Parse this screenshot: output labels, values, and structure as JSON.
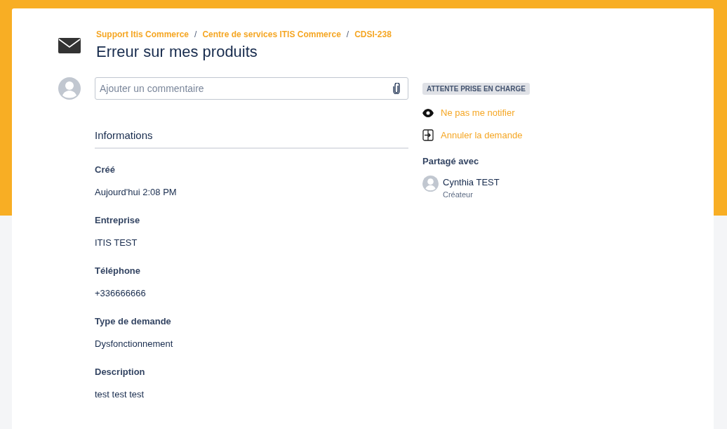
{
  "breadcrumbs": [
    "Support Itis Commerce",
    "Centre de services ITIS Commerce",
    "CDSI-238"
  ],
  "breadcrumb_separator": "/",
  "title": "Erreur sur mes produits",
  "comment": {
    "placeholder": "Ajouter un commentaire"
  },
  "informations": {
    "heading": "Informations",
    "fields": [
      {
        "label": "Créé",
        "value": "Aujourd'hui 2:08 PM"
      },
      {
        "label": "Entreprise",
        "value": "ITIS TEST"
      },
      {
        "label": "Téléphone",
        "value": "+336666666"
      },
      {
        "label": "Type de demande",
        "value": "Dysfonctionnement"
      },
      {
        "label": "Description",
        "value": "test test test"
      }
    ]
  },
  "status": "ATTENTE PRISE EN CHARGE",
  "actions": [
    {
      "kind": "watch",
      "label": "Ne pas me notifier"
    },
    {
      "kind": "cancel",
      "label": "Annuler la demande"
    }
  ],
  "shared": {
    "heading": "Partagé avec",
    "people": [
      {
        "name": "Cynthia TEST",
        "role": "Créateur"
      }
    ]
  }
}
